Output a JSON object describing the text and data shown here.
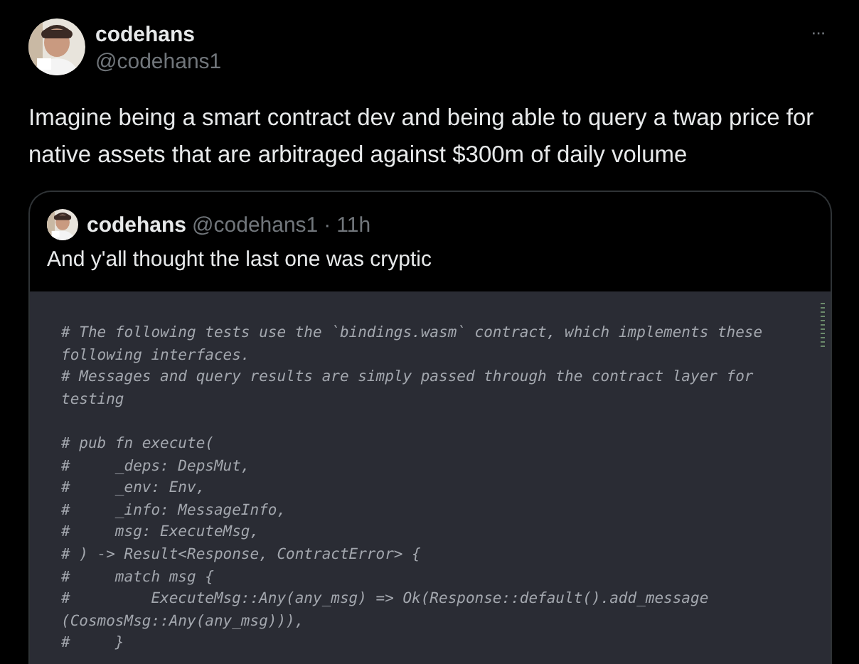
{
  "tweet": {
    "author": {
      "name": "codehans",
      "handle": "@codehans1"
    },
    "text": "Imagine being a smart contract dev and being able to query a twap price for native assets that are arbitraged against $300m of daily volume",
    "more": "···",
    "quote": {
      "author": {
        "name": "codehans",
        "handle": "@codehans1"
      },
      "separator": "·",
      "time": "11h",
      "text": "And y'all thought the last one was cryptic",
      "code_blocks": [
        [
          "# The following tests use the `bindings.wasm` contract, which implements these",
          "following interfaces.",
          "# Messages and query results are simply passed through the contract layer for",
          "testing"
        ],
        [
          "# pub fn execute(",
          "#     _deps: DepsMut,",
          "#     _env: Env,",
          "#     _info: MessageInfo,",
          "#     msg: ExecuteMsg,",
          "# ) -> Result<Response, ContractError> {",
          "#     match msg {",
          "#         ExecuteMsg::Any(any_msg) => Ok(Response::default().add_message",
          "(CosmosMsg::Any(any_msg))),",
          "#     }"
        ]
      ]
    }
  }
}
